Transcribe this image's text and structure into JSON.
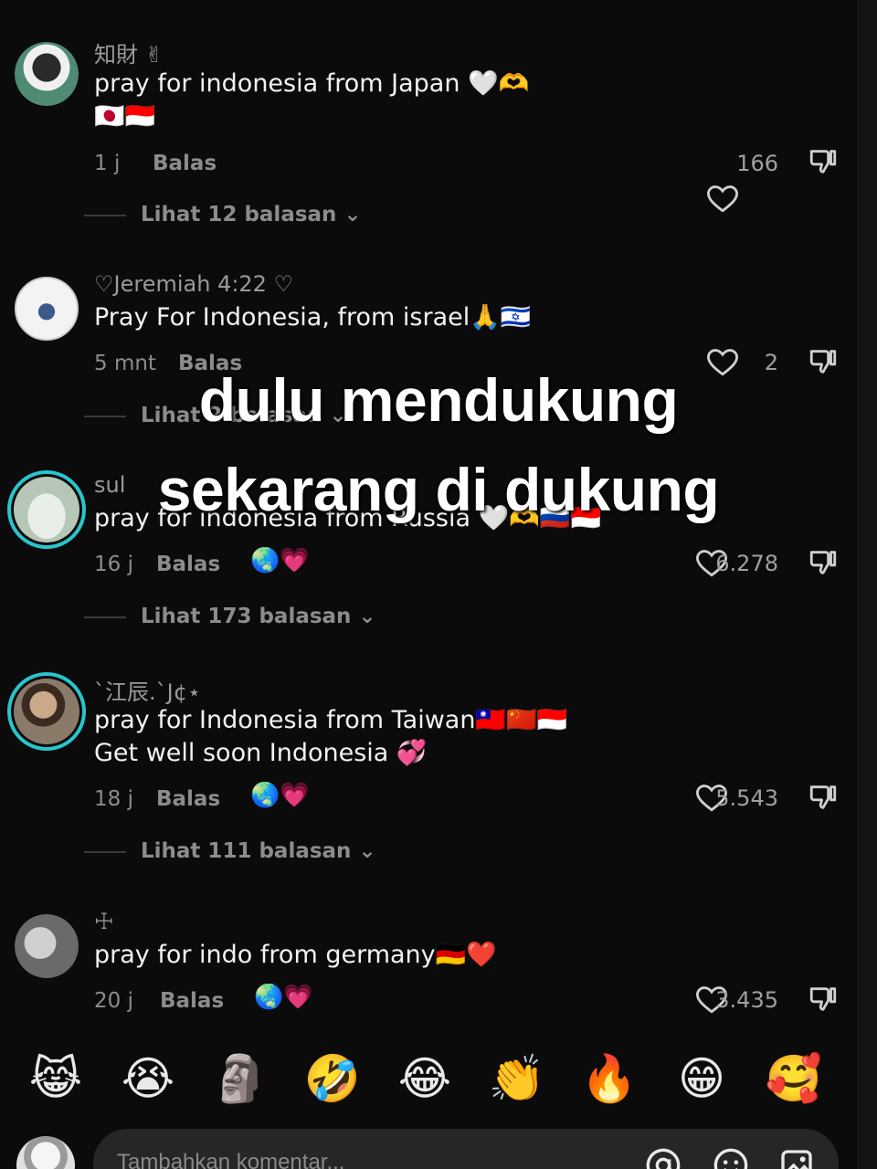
{
  "overlay": {
    "line1": "dulu mendukung",
    "line2": "sekarang di dukung"
  },
  "comments": [
    {
      "username": "知財 ✌",
      "lines": [
        "pray for indonesia from Japan 🤍🫶",
        "🇯🇵🇮🇩"
      ],
      "time": "1 j",
      "reply_label": "Balas",
      "likes": "166",
      "view_replies": "Lihat 12 balasan ⌄",
      "avatar_color": "#3a6a5a"
    },
    {
      "username": "♡Jeremiah 4:22 ♡",
      "lines": [
        "Pray For Indonesia, from israel🙏🇮🇱"
      ],
      "time": "5 mnt",
      "reply_label": "Balas",
      "likes": "2",
      "view_replies": "Lihat 2 balasan ⌄",
      "avatar_color": "#f3f3f3"
    },
    {
      "username": "sul",
      "lines": [
        "pray for indonesia from Russia 🤍🫶🇷🇺🇮🇩"
      ],
      "time": "16 j",
      "reply_label": "Balas",
      "sticker": "🌏💗",
      "likes": "6.278",
      "view_replies": "Lihat 173 balasan ⌄",
      "avatar_color": "#c8d6c8"
    },
    {
      "username": "ˋ江辰.ˋJ¢⋆",
      "lines": [
        "pray for Indonesia from Taiwan🇹🇼🇨🇳🇮🇩",
        "Get well soon Indonesia 💞"
      ],
      "time": "18 j",
      "reply_label": "Balas",
      "sticker": "🌏💗",
      "likes": "5.543",
      "view_replies": "Lihat 111 balasan ⌄",
      "avatar_color": "#8a7a6a"
    },
    {
      "username": "☩",
      "lines": [
        "pray for indo from germany🇩🇪❤️"
      ],
      "time": "20 j",
      "reply_label": "Balas",
      "sticker": "🌏💗",
      "likes": "3.435",
      "avatar_color": "#9a9a9a"
    }
  ],
  "emoji_bar": [
    "😹",
    "😭",
    "🗿",
    "🤣",
    "😂",
    "👏",
    "🔥",
    "😁",
    "🥰"
  ],
  "composer": {
    "placeholder": "Tambahkan komentar..."
  },
  "colors": {
    "background": "#0b0b0b",
    "ring": "#27c6cc",
    "muted_text": "#8c8c8c"
  }
}
